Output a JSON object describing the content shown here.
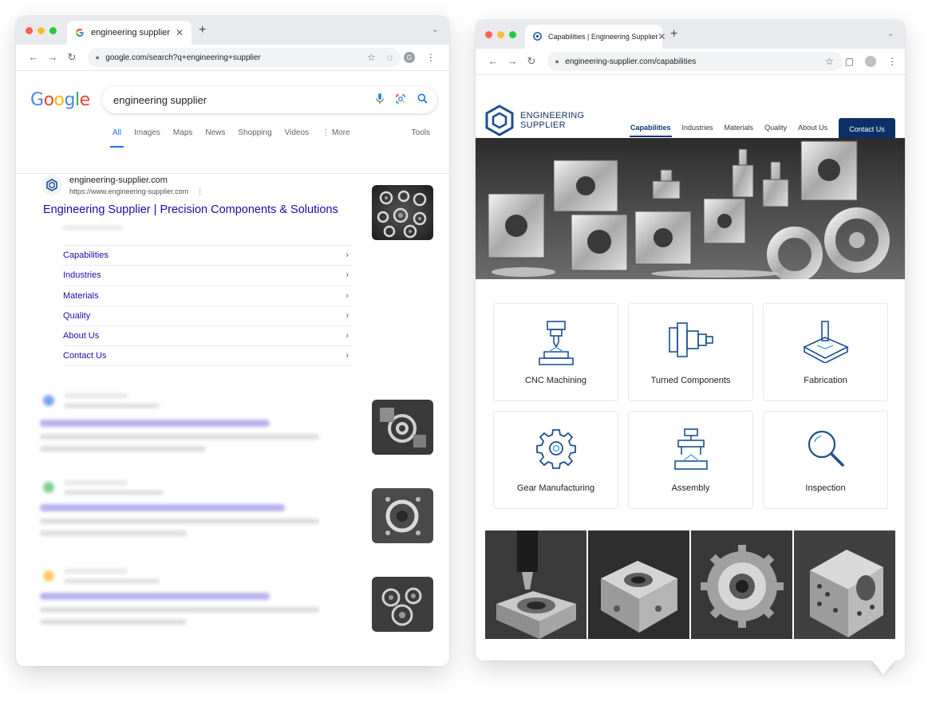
{
  "left_window": {
    "tab_title": "engineering supplier",
    "url": "google.com/search?q+engineering+supplier",
    "avatar_letter": "G",
    "logo_letters": [
      {
        "ch": "G",
        "color": "#4285f4"
      },
      {
        "ch": "o",
        "color": "#ea4335"
      },
      {
        "ch": "o",
        "color": "#fbbc05"
      },
      {
        "ch": "g",
        "color": "#4285f4"
      },
      {
        "ch": "l",
        "color": "#34a853"
      },
      {
        "ch": "e",
        "color": "#ea4335"
      }
    ],
    "search_query": "engineering supplier",
    "tabs": [
      "All",
      "Images",
      "Maps",
      "News",
      "Shopping",
      "Videos",
      "⋮ More"
    ],
    "tools_label": "Tools",
    "result": {
      "site_name": "engineering-supplier.com",
      "site_url": "https://www.engineering-supplier.com",
      "title": "Engineering Supplier | Precision Components & Solutions",
      "sitelinks": [
        "Capabilities",
        "Industries",
        "Materials",
        "Quality",
        "About Us",
        "Contact Us"
      ]
    },
    "blurred_results": [
      {
        "dot_color": "#7aa6e8"
      },
      {
        "dot_color": "#7fcf95"
      },
      {
        "dot_color": "#f6cc6a"
      }
    ]
  },
  "right_window": {
    "tab_title": "Capabilities | Engineering Supplier",
    "url": "engineering-supplier.com/capabilities",
    "brand": {
      "line1": "ENGINEERING",
      "line2": "SUPPLIER"
    },
    "nav": [
      "Capabilities",
      "Industries",
      "Materials",
      "Quality",
      "About Us"
    ],
    "nav_active": "Capabilities",
    "cta": "Contact Us",
    "cards": [
      {
        "label": "CNC Machining",
        "icon": "cnc-machine-icon"
      },
      {
        "label": "Turned Components",
        "icon": "turned-part-icon"
      },
      {
        "label": "Fabrication",
        "icon": "fabrication-icon"
      },
      {
        "label": "Gear Manufacturing",
        "icon": "gear-icon"
      },
      {
        "label": "Assembly",
        "icon": "assembly-icon"
      },
      {
        "label": "Inspection",
        "icon": "magnifier-icon"
      }
    ],
    "colors": {
      "brand_navy": "#0d3167",
      "icon_blue": "#1d4f91"
    }
  }
}
